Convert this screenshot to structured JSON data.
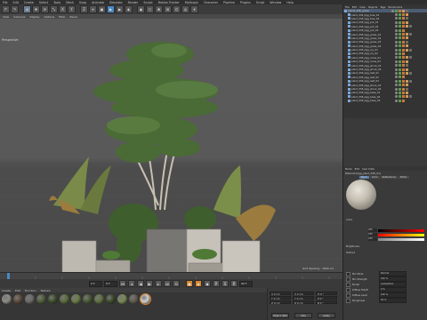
{
  "menubar": {
    "items": [
      "File",
      "Edit",
      "Create",
      "Select",
      "Tools",
      "Mesh",
      "Snap",
      "Animate",
      "Simulate",
      "Render",
      "Sculpt",
      "Motion Tracker",
      "MoGraph",
      "Character",
      "Pipeline",
      "Plugins",
      "Script",
      "Window",
      "Help"
    ]
  },
  "toolbar": {
    "buttons": [
      "↶",
      "↷",
      "⊕",
      "✥",
      "⟳",
      "⤡",
      "X",
      "Y",
      "Z",
      "⌖",
      "▣",
      "▶",
      "▶",
      "◈",
      "◉",
      "⬡",
      "❀",
      "⊞",
      "⌬",
      "◎",
      "☀"
    ]
  },
  "viewport": {
    "menu": [
      "View",
      "Cameras",
      "Display",
      "Options",
      "Filter",
      "Panel"
    ],
    "label": "Perspective",
    "info": "Grid Spacing : 1000 cm"
  },
  "transport": {
    "start_frame": "0 F",
    "end_frame": "90 F",
    "current_frame": "0 F"
  },
  "materials": {
    "menu": [
      "Create",
      "Edit",
      "Function",
      "Texture"
    ],
    "swatches": [
      "#8d8c86",
      "#5c4a3a",
      "#6b6b6b",
      "#4f5c3a",
      "#3d4d2c",
      "#5a6b3e",
      "#6b7a45",
      "#485a35",
      "#5f7040",
      "#3a4a2a",
      "#7a8a55",
      "#5e5a50",
      "#cfcfcf"
    ]
  },
  "coordinates": {
    "rows": [
      [
        "X  0 cm",
        "X  0 cm",
        "H  0 °"
      ],
      [
        "Y  0 cm",
        "Y  0 cm",
        "P  0 °"
      ],
      [
        "Z  0 cm",
        "Z  0 cm",
        "B  0 °"
      ]
    ],
    "mode": "Object (Rel)",
    "size_mode": "Size",
    "apply": "Apply"
  },
  "objects": {
    "menu": [
      "File",
      "Edit",
      "View",
      "Objects",
      "Tags",
      "Bookmarks"
    ],
    "rows": [
      "plants_036_group",
      "plant_036_bgg_tree_01",
      "plant_036_bgg_tree_02",
      "plant_036_bgg_pot_01",
      "plant_036_bgg_pot_02",
      "plant_036_bgg_pot_03",
      "plant_036_bgg_grass_01",
      "plant_036_bgg_grass_02",
      "plant_036_bgg_grass_03",
      "plant_036_bgg_grass_04",
      "plant_036_bgg_ivy_01",
      "plant_036_bgg_ivy_02",
      "plant_036_bgg_moss_01",
      "plant_036_bgg_moss_02",
      "plant_036_bgg_shrub_01",
      "plant_036_bgg_shrub_02",
      "plant_036_bgg_leaf_01",
      "plant_036_bgg_leaf_02",
      "plant_036_bgg_leaf_03",
      "plant_036_bgg_stone_01",
      "plant_036_bgg_stone_02",
      "plant_036_bgg_base_01",
      "plant_036_bgg_base_02",
      "plant_036_bgg_base_03"
    ]
  },
  "attributes": {
    "menu": [
      "Mode",
      "Edit",
      "User Data"
    ],
    "title": "Material [bgg_plant_036_01]",
    "tabs": [
      "Basic",
      "Color",
      "Reflectance",
      "Editor"
    ],
    "color_label": "Color",
    "values": [
      "255",
      "255",
      "255"
    ],
    "brightness_label": "Brightness",
    "texture_label": "Texture",
    "props": [
      [
        "Mix Mode",
        "Normal"
      ],
      [
        "Mix Strength",
        "100 %"
      ],
      [
        "Model",
        "Lambertian"
      ],
      [
        "Diffuse Falloff",
        "0 %"
      ],
      [
        "Diffuse Level",
        "100 %"
      ],
      [
        "Roughness",
        "50 %"
      ]
    ]
  },
  "colors": {
    "accent": "#d9832b",
    "selection": "#4c5d73"
  }
}
